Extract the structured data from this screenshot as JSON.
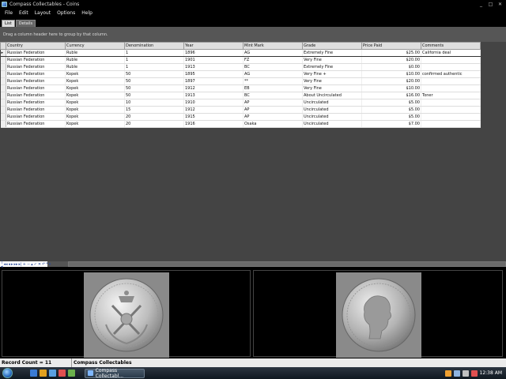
{
  "window": {
    "title": "Compass Collectables - Coins"
  },
  "menu": [
    "File",
    "Edit",
    "Layout",
    "Options",
    "Help"
  ],
  "tabs": [
    "List",
    "Details"
  ],
  "group_hint": "Drag a column header here to group by that column.",
  "grid": {
    "columns": [
      "Country",
      "Currency",
      "Denomination",
      "Year",
      "Mint Mark",
      "Grade",
      "Price Paid",
      "Comments"
    ],
    "rows": [
      [
        "Russian Federation",
        "Ruble",
        "1",
        "1896",
        "AG",
        "Extremely Fine",
        "$25.00",
        "California deal"
      ],
      [
        "Russian Federation",
        "Ruble",
        "1",
        "1901",
        "FZ",
        "Very Fine",
        "$20.00",
        ""
      ],
      [
        "Russian Federation",
        "Ruble",
        "1",
        "1913",
        "BC",
        "Extremely Fine",
        "$0.00",
        ""
      ],
      [
        "Russian Federation",
        "Kopek",
        "50",
        "1895",
        "AG",
        "Very Fine +",
        "$10.00",
        "confirmed authentic"
      ],
      [
        "Russian Federation",
        "Kopek",
        "50",
        "1897",
        "**",
        "Very Fine",
        "$20.00",
        ""
      ],
      [
        "Russian Federation",
        "Kopek",
        "50",
        "1912",
        "EB",
        "Very Fine",
        "$10.00",
        ""
      ],
      [
        "Russian Federation",
        "Kopek",
        "50",
        "1913",
        "BC",
        "About Uncirculated",
        "$16.00",
        "Toner"
      ],
      [
        "Russian Federation",
        "Kopek",
        "10",
        "1910",
        "AP",
        "Uncirculated",
        "$5.00",
        ""
      ],
      [
        "Russian Federation",
        "Kopek",
        "15",
        "1912",
        "AP",
        "Uncirculated",
        "$5.00",
        ""
      ],
      [
        "Russian Federation",
        "Kopek",
        "20",
        "1915",
        "AP",
        "Uncirculated",
        "$5.00",
        ""
      ],
      [
        "Russian Federation",
        "Kopek",
        "20",
        "1916",
        "Osaka",
        "Uncirculated",
        "$7.00",
        ""
      ]
    ]
  },
  "navigator": [
    "|◂",
    "◂◂",
    "◂",
    "▸",
    "▸▸",
    "▸|",
    "+",
    "−",
    "▴",
    "✓",
    "✕",
    "↶",
    "*",
    "▾"
  ],
  "status": {
    "record_count": "Record Count = 11",
    "app": "Compass Collectables"
  },
  "taskbar": {
    "button": "Compass Collectabl...",
    "clock": "12:38 AM"
  },
  "colors": {
    "grid_header": "#dedede",
    "groupbar": "#565656",
    "coin": "#8a8a8a"
  }
}
